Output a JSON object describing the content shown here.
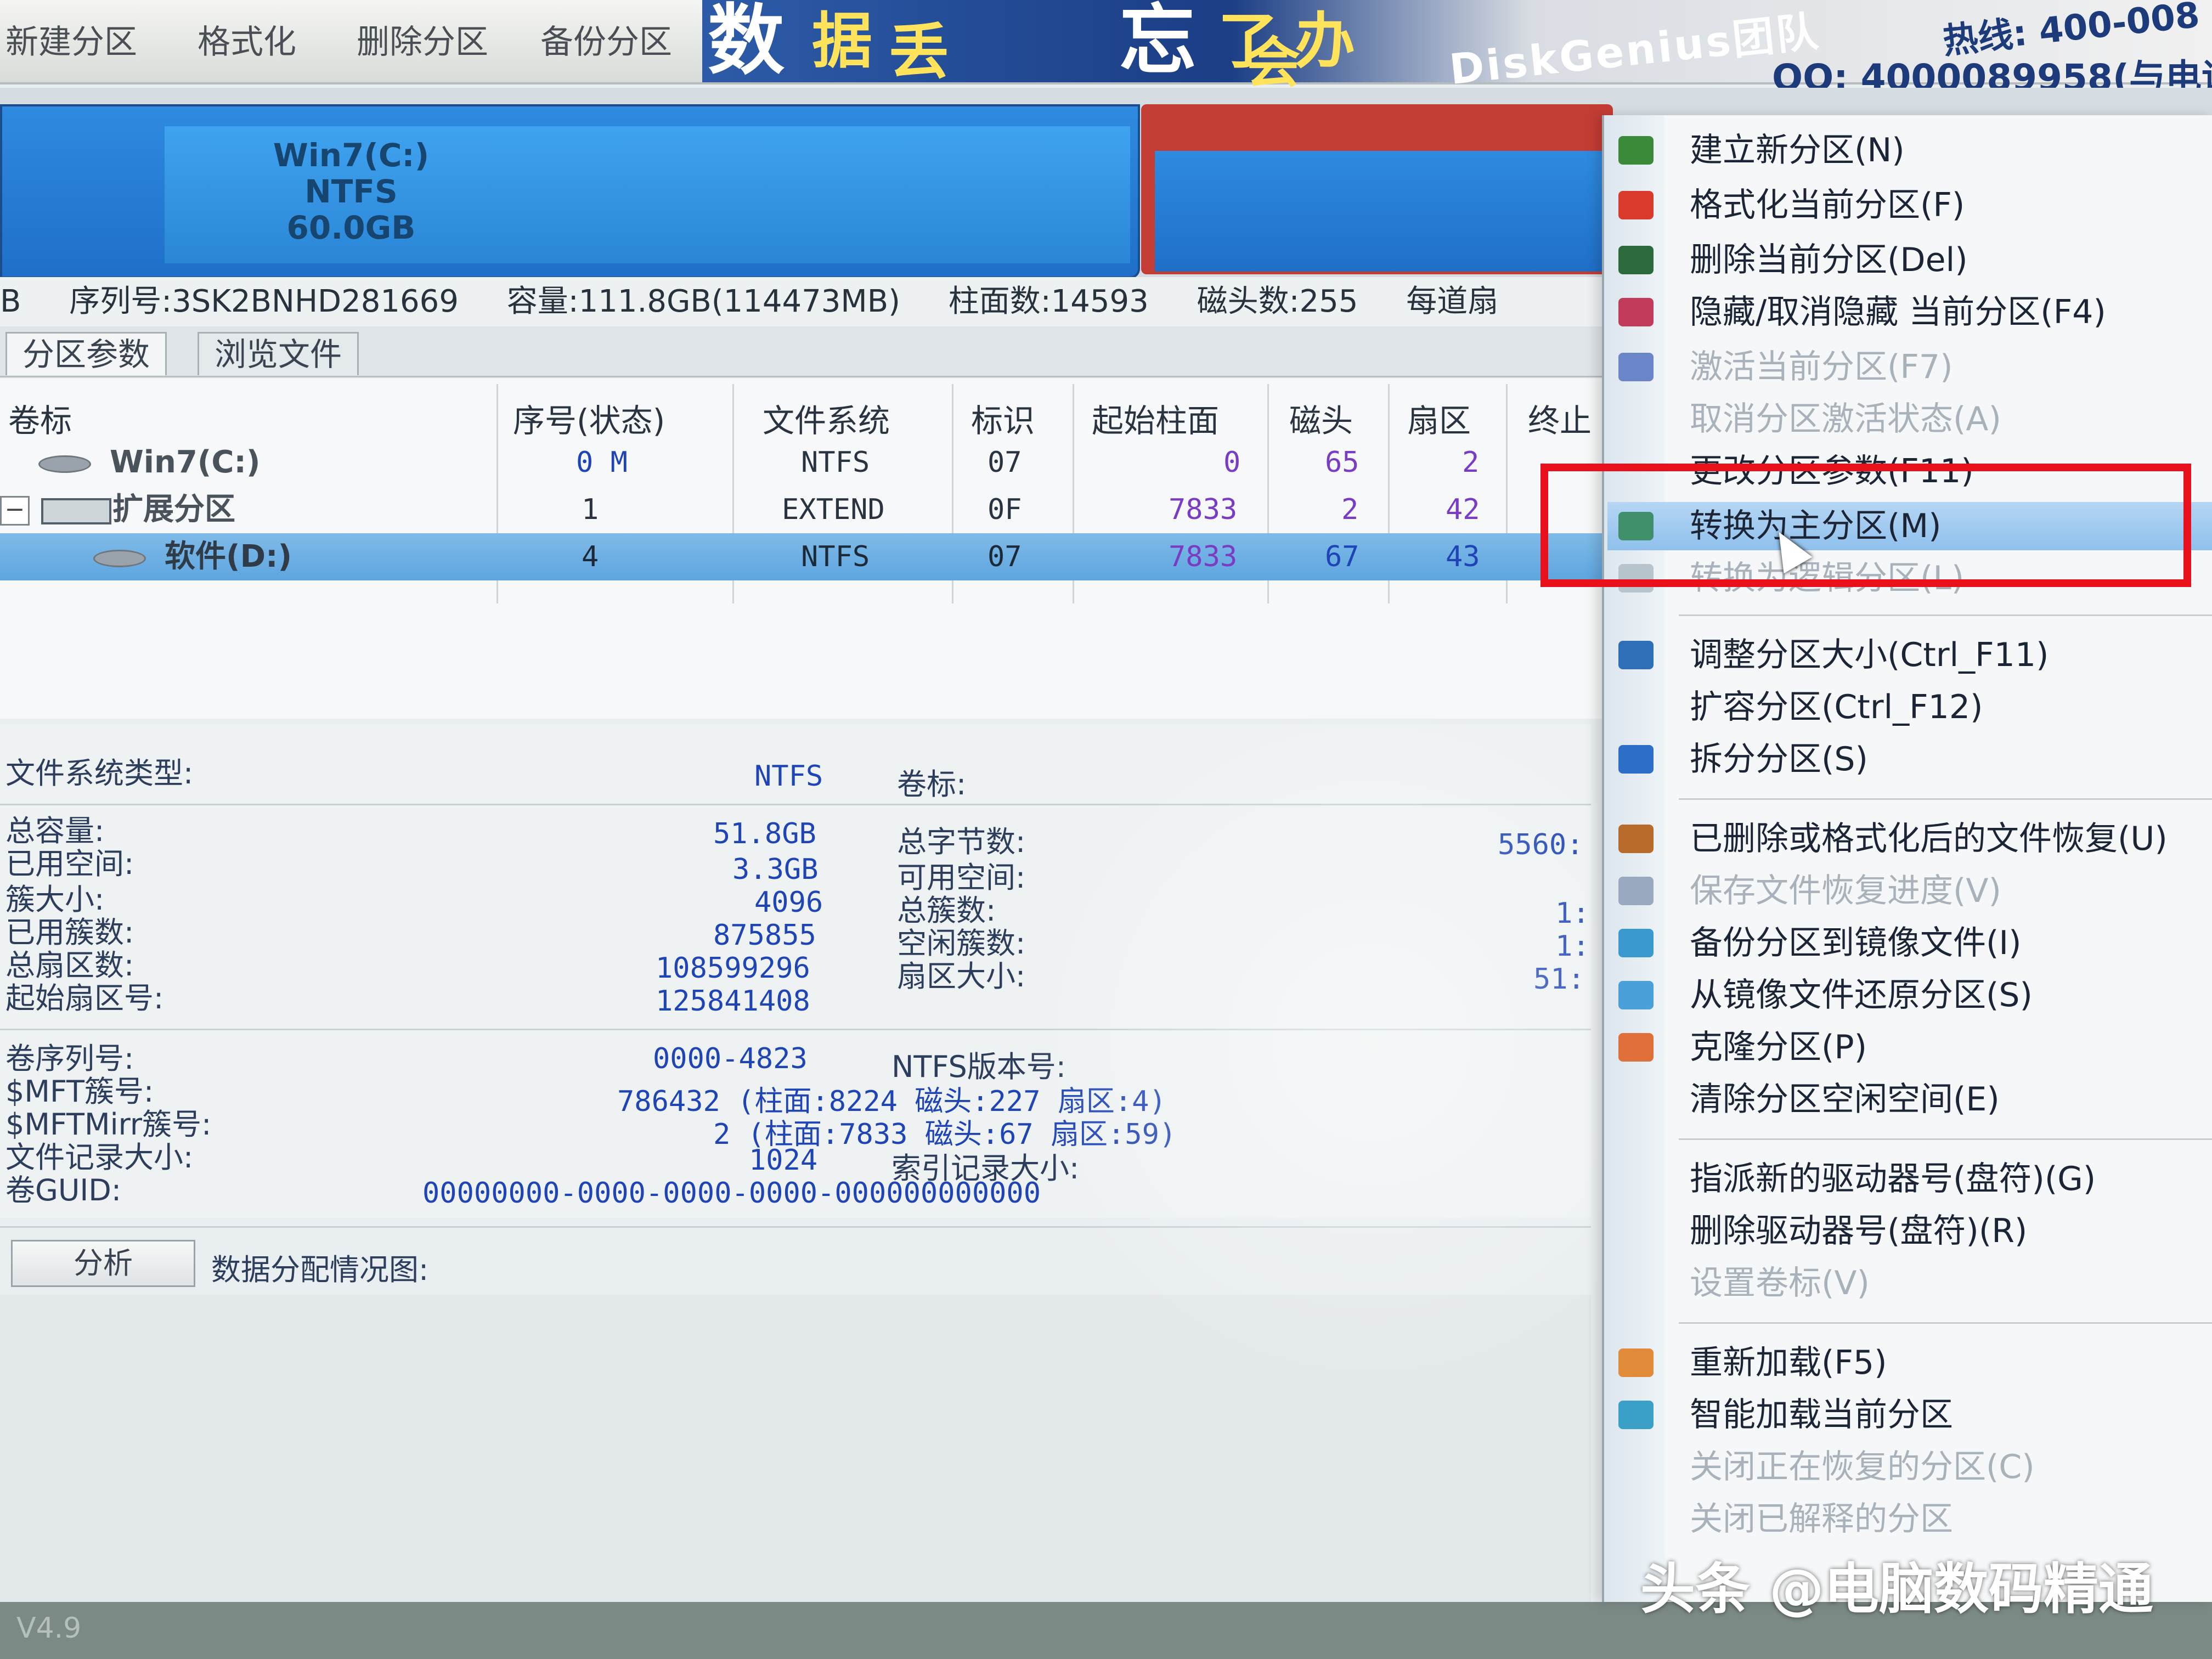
{
  "toolbar": {
    "buttons": [
      "新建分区",
      "格式化",
      "删除分区",
      "备份分区"
    ],
    "banner_chars": [
      "数",
      "据",
      "丢",
      "忘",
      "了",
      "办",
      "会"
    ],
    "brand": "DiskGenius团队",
    "hotline": "热线: 400-008",
    "qq": "QQ: 4000089958(与电话"
  },
  "partition_bar": {
    "c_label": [
      "Win7(C:)",
      "NTFS",
      "60.0GB"
    ]
  },
  "disk_info": {
    "model_tail": "B",
    "serial": "序列号:3SK2BNHD281669",
    "capacity": "容量:111.8GB(114473MB)",
    "cylinders": "柱面数:14593",
    "heads": "磁头数:255",
    "sectors_per_track": "每道扇"
  },
  "tabs": [
    "分区参数",
    "浏览文件"
  ],
  "table": {
    "headers": [
      "卷标",
      "序号(状态)",
      "文件系统",
      "标识",
      "起始柱面",
      "磁头",
      "扇区",
      "终止"
    ],
    "rows": [
      {
        "name": "Win7(C:)",
        "index": "0 M",
        "fs": "NTFS",
        "id": "07",
        "start_cyl": "0",
        "head": "65",
        "sector": "2"
      },
      {
        "name": "扩展分区",
        "index": "1",
        "fs": "EXTEND",
        "id": "0F",
        "start_cyl": "7833",
        "head": "2",
        "sector": "42"
      },
      {
        "name": "软件(D:)",
        "index": "4",
        "fs": "NTFS",
        "id": "07",
        "start_cyl": "7833",
        "head": "67",
        "sector": "43"
      }
    ]
  },
  "details": {
    "fs_type_label": "文件系统类型:",
    "fs_type": "NTFS",
    "volume_label": "卷标:",
    "total_capacity_label": "总容量:",
    "total_capacity": "51.8GB",
    "total_bytes_label": "总字节数:",
    "total_bytes": "5560:",
    "used_space_label": "已用空间:",
    "used_space": "3.3GB",
    "free_space_label": "可用空间:",
    "cluster_size_label": "簇大小:",
    "cluster_size": "4096",
    "total_clusters_label": "总簇数:",
    "total_clusters": "1:",
    "used_clusters_label": "已用簇数:",
    "used_clusters": "875855",
    "free_clusters_label": "空闲簇数:",
    "free_clusters": "1:",
    "total_sectors_label": "总扇区数:",
    "total_sectors": "108599296",
    "sector_size_label": "扇区大小:",
    "sector_size": "51:",
    "start_sector_label": "起始扇区号:",
    "start_sector": "125841408",
    "volume_serial_label": "卷序列号:",
    "volume_serial": "0000-4823",
    "ntfs_version_label": "NTFS版本号:",
    "mft_cluster_label": "$MFT簇号:",
    "mft_cluster": "786432 (柱面:8224 磁头:227 扇区:4)",
    "mftmirr_cluster_label": "$MFTMirr簇号:",
    "mftmirr_cluster": "2 (柱面:7833 磁头:67 扇区:59)",
    "file_record_size_label": "文件记录大小:",
    "file_record_size": "1024",
    "index_record_size_label": "索引记录大小:",
    "guid_label": "卷GUID:",
    "guid": "00000000-0000-0000-0000-000000000000"
  },
  "analyze_button": "分析",
  "alloc_label": "数据分配情况图:",
  "version": "V4.9",
  "menu": {
    "items": [
      {
        "label": "建立新分区(N)",
        "icon_color": "#3a8a3a",
        "disabled": false,
        "highlight": false
      },
      {
        "label": "格式化当前分区(F)",
        "icon_color": "#d93a2b",
        "disabled": false,
        "highlight": false
      },
      {
        "label": "删除当前分区(Del)",
        "icon_color": "#2b6a3a",
        "disabled": false,
        "highlight": false
      },
      {
        "label": "隐藏/取消隐藏 当前分区(F4)",
        "icon_color": "#c23b5a",
        "disabled": false,
        "highlight": false
      },
      {
        "label": "激活当前分区(F7)",
        "icon_color": "#6a86c9",
        "disabled": true,
        "highlight": false
      },
      {
        "label": "取消分区激活状态(A)",
        "icon_color": "",
        "disabled": true,
        "highlight": false
      },
      {
        "label": "更改分区参数(F11)",
        "icon_color": "",
        "disabled": false,
        "highlight": false
      },
      {
        "label": "转换为主分区(M)",
        "icon_color": "#3f8f6a",
        "disabled": false,
        "highlight": true
      },
      {
        "label": "转换为逻辑分区(L)",
        "icon_color": "#b8c4cc",
        "disabled": true,
        "highlight": false
      },
      {
        "label": "调整分区大小(Ctrl_F11)",
        "icon_color": "#2f6fb8",
        "disabled": false,
        "highlight": false
      },
      {
        "label": "扩容分区(Ctrl_F12)",
        "icon_color": "",
        "disabled": false,
        "highlight": false
      },
      {
        "label": "拆分分区(S)",
        "icon_color": "#2c6ec8",
        "disabled": false,
        "highlight": false
      },
      {
        "label": "已删除或格式化后的文件恢复(U)",
        "icon_color": "#b86a2b",
        "disabled": false,
        "highlight": false
      },
      {
        "label": "保存文件恢复进度(V)",
        "icon_color": "#9aa8c0",
        "disabled": true,
        "highlight": false
      },
      {
        "label": "备份分区到镜像文件(I)",
        "icon_color": "#3a9ad0",
        "disabled": false,
        "highlight": false
      },
      {
        "label": "从镜像文件还原分区(S)",
        "icon_color": "#4aa0d8",
        "disabled": false,
        "highlight": false
      },
      {
        "label": "克隆分区(P)",
        "icon_color": "#e0703a",
        "disabled": false,
        "highlight": false
      },
      {
        "label": "清除分区空闲空间(E)",
        "icon_color": "",
        "disabled": false,
        "highlight": false
      },
      {
        "label": "指派新的驱动器号(盘符)(G)",
        "icon_color": "",
        "disabled": false,
        "highlight": false
      },
      {
        "label": "删除驱动器号(盘符)(R)",
        "icon_color": "",
        "disabled": false,
        "highlight": false
      },
      {
        "label": "设置卷标(V)",
        "icon_color": "",
        "disabled": true,
        "highlight": false
      },
      {
        "label": "重新加载(F5)",
        "icon_color": "#e08a3a",
        "disabled": false,
        "highlight": false
      },
      {
        "label": "智能加载当前分区",
        "icon_color": "#3aa0c8",
        "disabled": false,
        "highlight": false
      },
      {
        "label": "关闭正在恢复的分区(C)",
        "icon_color": "",
        "disabled": true,
        "highlight": false
      },
      {
        "label": "关闭已解释的分区",
        "icon_color": "",
        "disabled": true,
        "highlight": false
      }
    ]
  },
  "watermark": "头条 @电脑数码精通"
}
